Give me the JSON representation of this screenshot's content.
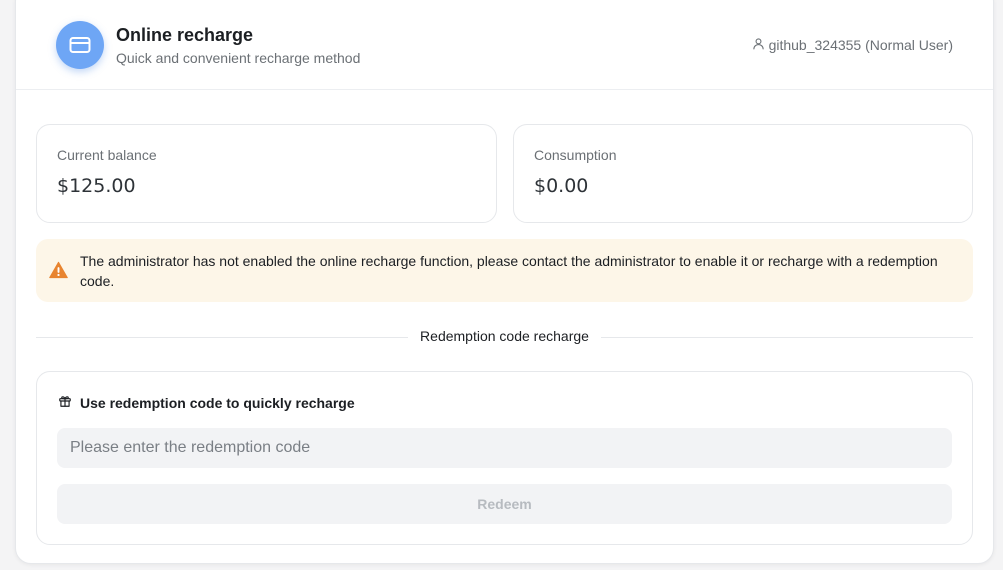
{
  "header": {
    "title": "Online recharge",
    "subtitle": "Quick and convenient recharge method",
    "user_label": "github_324355 (Normal User)",
    "icons": {
      "avatar": "credit-card-icon",
      "user": "user-icon"
    }
  },
  "stats": {
    "balance": {
      "label": "Current balance",
      "value": "$125.00"
    },
    "consumption": {
      "label": "Consumption",
      "value": "$0.00"
    }
  },
  "alert": {
    "icon": "warning-icon",
    "message": "The administrator has not enabled the online recharge function, please contact the administrator to enable it or recharge with a redemption code."
  },
  "divider": {
    "text": "Redemption code recharge"
  },
  "redeem": {
    "icon": "gift-icon",
    "heading": "Use redemption code to quickly recharge",
    "input_value": "",
    "input_placeholder": "Please enter the redemption code",
    "button_label": "Redeem"
  },
  "colors": {
    "accent": "#6ea6f5",
    "warning": "#e8842f",
    "alert_bg": "#fdf6e8"
  }
}
